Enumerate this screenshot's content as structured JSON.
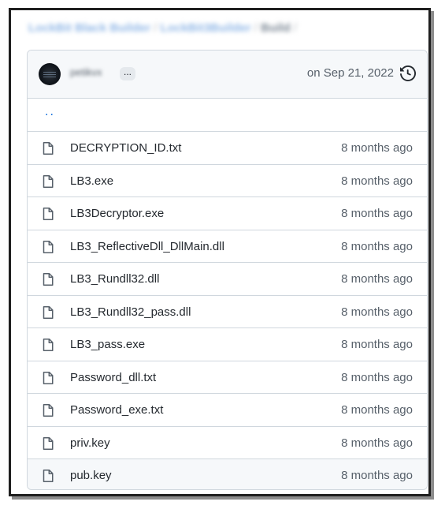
{
  "breadcrumb": {
    "owner": "LockBit Black Builder",
    "separator": "/",
    "repo": "LockBit3Builder",
    "folder": "Build"
  },
  "commit": {
    "author": "petikvx",
    "ellipsis": "...",
    "date": "on Sep 21, 2022",
    "history_icon": "history-icon"
  },
  "parent_link": "..",
  "files": [
    {
      "name": "DECRYPTION_ID.txt",
      "age": "8 months ago",
      "icon": "file-icon"
    },
    {
      "name": "LB3.exe",
      "age": "8 months ago",
      "icon": "file-icon"
    },
    {
      "name": "LB3Decryptor.exe",
      "age": "8 months ago",
      "icon": "file-icon"
    },
    {
      "name": "LB3_ReflectiveDll_DllMain.dll",
      "age": "8 months ago",
      "icon": "file-icon"
    },
    {
      "name": "LB3_Rundll32.dll",
      "age": "8 months ago",
      "icon": "file-icon"
    },
    {
      "name": "LB3_Rundll32_pass.dll",
      "age": "8 months ago",
      "icon": "file-icon"
    },
    {
      "name": "LB3_pass.exe",
      "age": "8 months ago",
      "icon": "file-icon"
    },
    {
      "name": "Password_dll.txt",
      "age": "8 months ago",
      "icon": "file-icon"
    },
    {
      "name": "Password_exe.txt",
      "age": "8 months ago",
      "icon": "file-icon"
    },
    {
      "name": "priv.key",
      "age": "8 months ago",
      "icon": "file-icon"
    },
    {
      "name": "pub.key",
      "age": "8 months ago",
      "icon": "file-icon"
    }
  ],
  "colors": {
    "link": "#0969da",
    "border": "#d0d7de",
    "header_bg": "#f6f8fa",
    "muted_text": "#57606a",
    "text": "#24292f"
  }
}
